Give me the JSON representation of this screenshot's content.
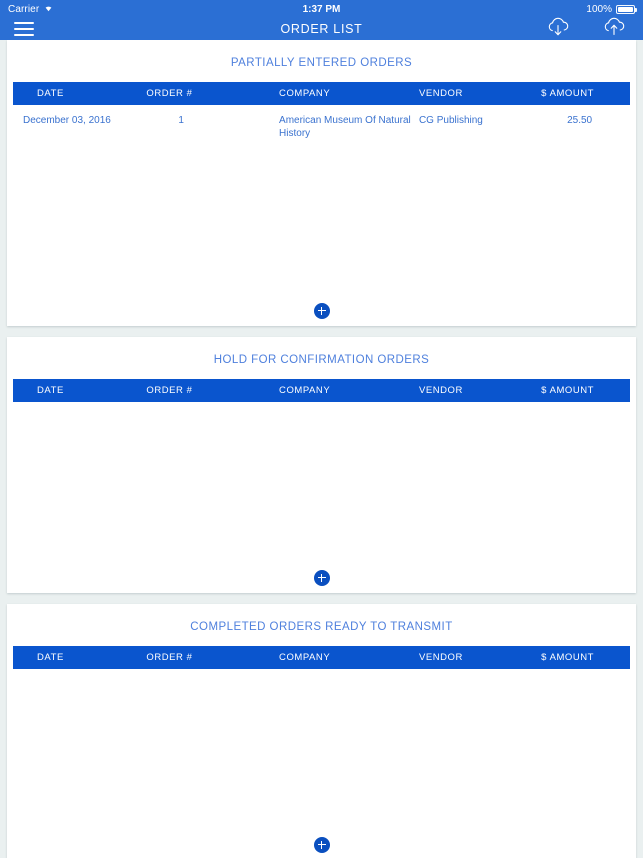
{
  "status_bar": {
    "carrier": "Carrier",
    "wifi_icon": "wifi-icon",
    "time": "1:37 PM",
    "battery_percent": "100%",
    "battery_icon": "battery-full-icon"
  },
  "nav_bar": {
    "menu_icon": "hamburger-menu-icon",
    "title": "ORDER LIST",
    "download_icon": "cloud-download-icon",
    "upload_icon": "cloud-upload-icon"
  },
  "colors": {
    "nav_blue": "#2b6fd4",
    "table_header_blue": "#0a55ce",
    "link_blue": "#3a72cf",
    "section_title_blue": "#4f80dd",
    "page_background": "#eaf0f0",
    "add_button_blue": "#0a4fbf"
  },
  "table_columns": [
    "DATE",
    "ORDER #",
    "COMPANY",
    "VENDOR",
    "$ AMOUNT"
  ],
  "sections": [
    {
      "title": "PARTIALLY ENTERED ORDERS",
      "columns": [
        "DATE",
        "ORDER #",
        "COMPANY",
        "VENDOR",
        "$ AMOUNT"
      ],
      "rows": [
        {
          "date": "December 03, 2016",
          "order": "1",
          "company": "American Museum Of Natural History",
          "vendor": "CG Publishing",
          "amount": "25.50"
        }
      ],
      "add_label": "+"
    },
    {
      "title": "HOLD FOR CONFIRMATION ORDERS",
      "columns": [
        "DATE",
        "ORDER #",
        "COMPANY",
        "VENDOR",
        "$ AMOUNT"
      ],
      "rows": [],
      "add_label": "+"
    },
    {
      "title": "COMPLETED ORDERS READY TO TRANSMIT",
      "columns": [
        "DATE",
        "ORDER #",
        "COMPANY",
        "VENDOR",
        "$ AMOUNT"
      ],
      "rows": [],
      "add_label": "+"
    }
  ]
}
